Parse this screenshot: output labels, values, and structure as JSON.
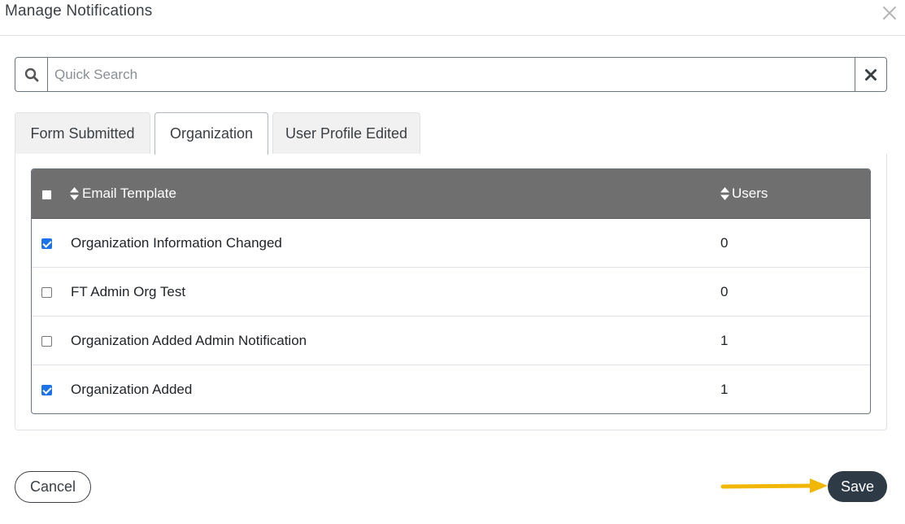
{
  "modal": {
    "title": "Manage Notifications"
  },
  "search": {
    "placeholder": "Quick Search",
    "value": ""
  },
  "tabs": [
    {
      "label": "Form Submitted",
      "active": false
    },
    {
      "label": "Organization",
      "active": true
    },
    {
      "label": "User Profile Edited",
      "active": false
    }
  ],
  "table": {
    "columns": {
      "template": "Email Template",
      "users": "Users"
    },
    "header_checkbox_checked": false,
    "rows": [
      {
        "template": "Organization Information Changed",
        "users": "0",
        "checked": true
      },
      {
        "template": "FT Admin Org Test",
        "users": "0",
        "checked": false
      },
      {
        "template": "Organization Added Admin Notification",
        "users": "1",
        "checked": false
      },
      {
        "template": "Organization Added",
        "users": "1",
        "checked": true
      }
    ]
  },
  "footer": {
    "cancel_label": "Cancel",
    "save_label": "Save"
  },
  "colors": {
    "header_bg": "#6f6f6f",
    "save_bg": "#2e3a46",
    "checkbox_checked": "#1a73e8",
    "arrow": "#f2b705"
  },
  "icons": {
    "search": "search-icon",
    "clear": "close-icon",
    "close": "close-icon",
    "sort": "sort-icon",
    "annotation": "arrow-icon"
  }
}
